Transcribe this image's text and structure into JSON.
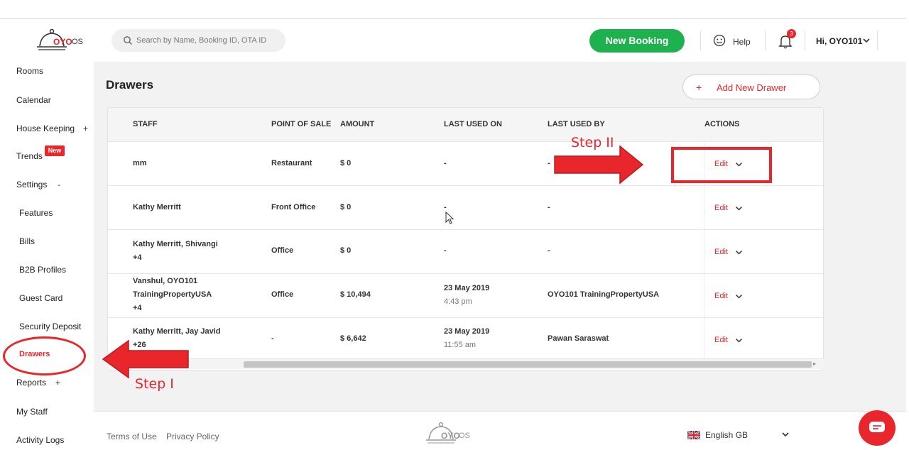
{
  "header": {
    "logo_text": "OYO",
    "logo_suffix": "OS",
    "search_placeholder": "Search by Name, Booking ID, OTA ID",
    "new_booking_label": "New Booking",
    "help_label": "Help",
    "notification_count": "3",
    "user_greeting": "Hi, OYO101"
  },
  "sidebar": {
    "rooms": "Rooms",
    "calendar": "Calendar",
    "house_keeping": "House Keeping",
    "house_keeping_suffix": "+",
    "trends": "Trends",
    "trends_badge": "New",
    "settings": "Settings",
    "settings_suffix": "-",
    "features": "Features",
    "bills": "Bills",
    "b2b_profiles": "B2B Profiles",
    "guest_card": "Guest Card",
    "security_deposit": "Security Deposit",
    "drawers": "Drawers",
    "reports": "Reports",
    "reports_suffix": "+",
    "my_staff": "My Staff",
    "activity_logs": "Activity Logs"
  },
  "page": {
    "title": "Drawers",
    "add_button_plus": "+",
    "add_button_label": "Add New Drawer"
  },
  "table": {
    "headers": [
      "STAFF",
      "POINT OF SALE",
      "AMOUNT",
      "LAST USED ON",
      "LAST USED BY",
      "ACTIONS"
    ],
    "edit_label": "Edit",
    "rows": [
      {
        "staff1": "mm",
        "staff2": "",
        "staff3": "",
        "pos": "Restaurant",
        "amount": "$ 0",
        "date": "-",
        "time": "",
        "by1": "-",
        "by2": ""
      },
      {
        "staff1": "Kathy Merritt",
        "staff2": "",
        "staff3": "",
        "pos": "Front Office",
        "amount": "$ 0",
        "date": "-",
        "time": "",
        "by1": "-",
        "by2": ""
      },
      {
        "staff1": "Kathy Merritt, Shivangi",
        "staff2": "+4",
        "staff3": "",
        "pos": "Office",
        "amount": "$ 0",
        "date": "-",
        "time": "",
        "by1": "-",
        "by2": ""
      },
      {
        "staff1": "Vanshul, OYO101",
        "staff2": "TrainingPropertyUSA",
        "staff3": "+4",
        "pos": "Office",
        "amount": "$ 10,494",
        "date": "23 May 2019",
        "time": "4:43 pm",
        "by1": "OYO101 TrainingPropertyUSA",
        "by2": ""
      },
      {
        "staff1": "Kathy Merritt, Jay Javid",
        "staff2": "+26",
        "staff3": "",
        "pos": "-",
        "amount": "$ 6,642",
        "date": "23 May 2019",
        "time": "11:55 am",
        "by1": "Pawan Saraswat",
        "by2": ""
      }
    ]
  },
  "footer": {
    "terms": "Terms of Use",
    "privacy": "Privacy Policy",
    "logo_text": "OYO",
    "logo_suffix": "OS",
    "language": "English GB"
  },
  "annotations": {
    "step1": "Step I",
    "step2": "Step II"
  },
  "colors": {
    "brand_red": "#e8262b",
    "green": "#1fb14d"
  }
}
